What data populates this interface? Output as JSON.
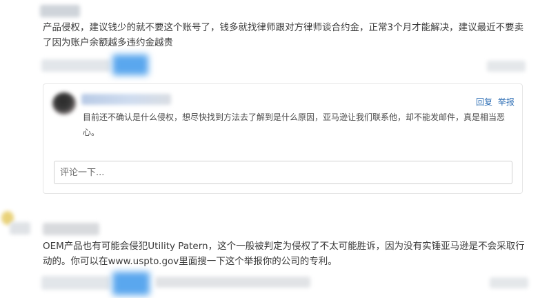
{
  "comments": [
    {
      "text": "产品侵权，建议钱少的就不要这个账号了，钱多就找律师跟对方律师谈合约金，正常3个月才能解决，建议最近不要卖了因为账户余额越多违约金越贵"
    },
    {
      "text": "OEM产品也有可能会侵犯Utility Patern，这个一般被判定为侵权了不太可能胜诉，因为没有实锤亚马逊是不会采取行动的。你可以在www.uspto.gov里面搜一下这个举报你的公司的专利。"
    }
  ],
  "reply": {
    "text": "目前还不确认是什么侵权，想尽快找到方法去了解到是什么原因，亚马逊让我们联系他，却不能发邮件，真是相当恶心。",
    "reply_label": "回复",
    "report_label": "举报",
    "input_placeholder": "评论一下..."
  }
}
